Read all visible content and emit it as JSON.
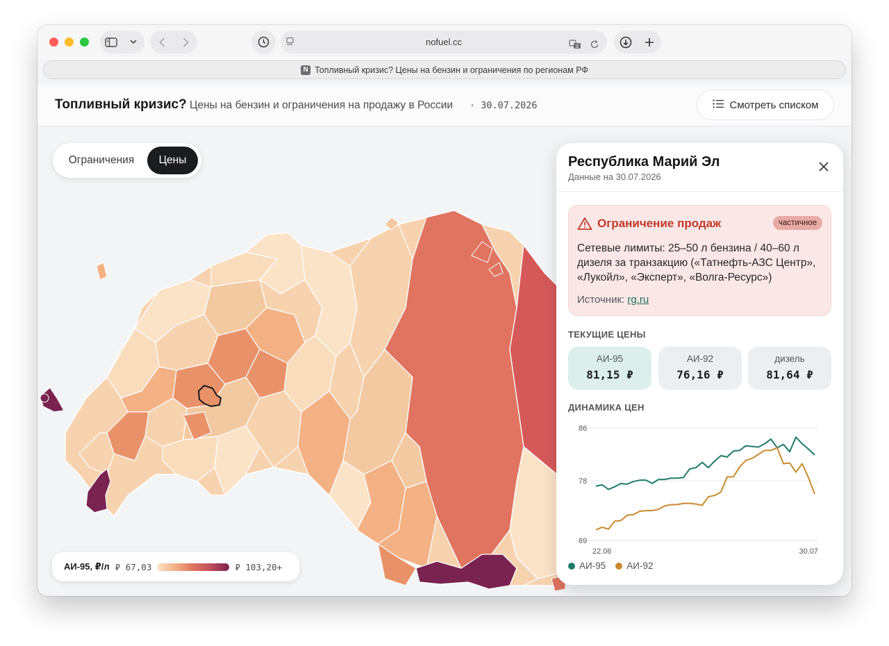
{
  "browser": {
    "url": "nofuel.cc",
    "tab_title": "Топливный кризис? Цены на бензин и ограничения по регионам РФ",
    "favicon_letter": "N"
  },
  "header": {
    "title": "Топливный кризис?",
    "subtitle": "Цены на бензин и ограничения на продажу в России",
    "date": "· 30.07.2026",
    "list_button": "Смотреть списком"
  },
  "mode_toggle": {
    "option_restrictions": "Ограничения",
    "option_prices": "Цены",
    "selected": "Цены"
  },
  "legend": {
    "title": "АИ-95, ₽/л",
    "min": "₽ 67,03",
    "max": "₽ 103,20+",
    "gradient_colors": [
      "#fbe3c8",
      "#f3b184",
      "#e07460",
      "#c04b5a",
      "#7a2350"
    ]
  },
  "map": {
    "selected_region": "Республика Марий Эл",
    "colors": {
      "lightest": "#fbe3c8",
      "light": "#f7d2ae",
      "mid": "#f3b184",
      "strong": "#e9926a",
      "hot": "#e07460",
      "hotter": "#d6595a",
      "darkest": "#7a2350"
    }
  },
  "panel": {
    "region_name": "Республика Марий Эл",
    "data_date": "Данные на 30.07.2026",
    "alert": {
      "title": "Ограничение продаж",
      "badge": "частичное",
      "body": "Сетевые лимиты: 25–50 л бензина / 40–60 л дизеля за транзакцию («Татнефть-АЗС Центр», «Лукойл», «Эксперт», «Волга-Ресурс»)",
      "source_label": "Источник:",
      "source_link": "rg.ru"
    },
    "prices_heading": "ТЕКУЩИЕ ЦЕНЫ",
    "prices": [
      {
        "label": "АИ-95",
        "value": "81,15 ₽",
        "active": true
      },
      {
        "label": "АИ-92",
        "value": "76,16 ₽",
        "active": false
      },
      {
        "label": "дизель",
        "value": "81,64 ₽",
        "active": false
      }
    ],
    "dynamics_heading": "ДИНАМИКА ЦЕН"
  },
  "chart_data": {
    "type": "line",
    "x_labels": [
      "22.06",
      "30.07"
    ],
    "y_ticks": [
      69,
      78,
      86
    ],
    "ylim": [
      69,
      86
    ],
    "grid": true,
    "series": [
      {
        "name": "АИ-95",
        "color": "#1f7a6b",
        "values": [
          77.2,
          77.4,
          76.7,
          77.1,
          77.6,
          77.5,
          77.9,
          78.1,
          78.1,
          77.6,
          78.2,
          78.2,
          78.4,
          78.4,
          78.5,
          79.8,
          80.0,
          80.8,
          80.0,
          81.0,
          81.8,
          81.6,
          82.5,
          82.6,
          83.3,
          83.2,
          83.1,
          83.6,
          84.3,
          83.0,
          83.5,
          82.4,
          84.6,
          83.6,
          82.8,
          81.9
        ]
      },
      {
        "name": "АИ-92",
        "color": "#c98a2e",
        "values": [
          70.6,
          71.0,
          70.7,
          71.9,
          72.0,
          72.8,
          72.9,
          73.4,
          73.5,
          73.5,
          73.7,
          74.2,
          74.4,
          74.4,
          74.6,
          74.6,
          74.5,
          74.3,
          75.6,
          75.8,
          76.3,
          78.6,
          78.6,
          80.1,
          81.1,
          81.4,
          82.0,
          82.6,
          82.6,
          83.0,
          80.6,
          80.7,
          79.3,
          80.6,
          78.5,
          76.0
        ]
      }
    ]
  }
}
